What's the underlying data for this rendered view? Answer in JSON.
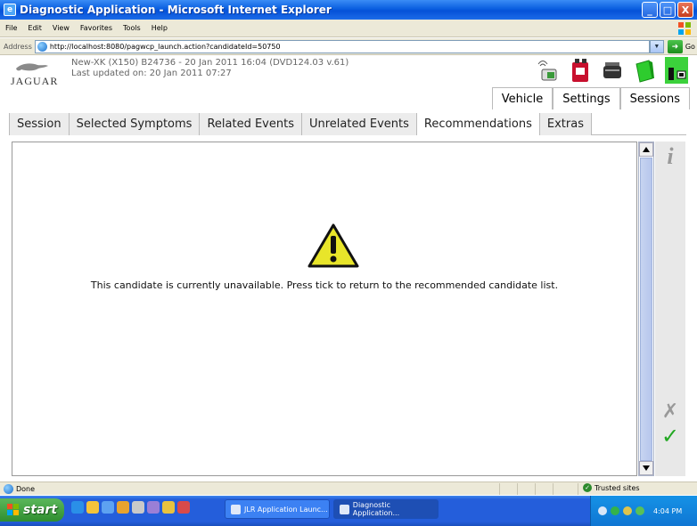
{
  "window": {
    "title": "Diagnostic Application - Microsoft Internet Explorer",
    "buttons": [
      "_",
      "□",
      "X"
    ]
  },
  "menu": {
    "items": [
      "File",
      "Edit",
      "View",
      "Favorites",
      "Tools",
      "Help"
    ]
  },
  "address": {
    "label": "Address",
    "url": "http://localhost:8080/pagwcp_launch.action?candidateId=50750",
    "go_label": "Go"
  },
  "header": {
    "logo_text": "JAGUAR",
    "vehicle_line": "New-XK (X150) B24736 - 20 Jan 2011 16:04 (DVD124.03 v.61)",
    "updated_line": "Last updated on: 20 Jan 2011 07:27",
    "tabs": [
      {
        "label": "Vehicle",
        "active": true
      },
      {
        "label": "Settings",
        "active": false
      },
      {
        "label": "Sessions",
        "active": false
      }
    ]
  },
  "main_tabs": [
    {
      "label": "Session",
      "active": false
    },
    {
      "label": "Selected Symptoms",
      "active": false
    },
    {
      "label": "Related Events",
      "active": false
    },
    {
      "label": "Unrelated Events",
      "active": false
    },
    {
      "label": "Recommendations",
      "active": true
    },
    {
      "label": "Extras",
      "active": false
    }
  ],
  "content": {
    "message": "This candidate is currently unavailable. Press tick to return to the recommended candidate list."
  },
  "side_panel": {
    "info_glyph": "i",
    "cancel_glyph": "✗",
    "confirm_glyph": "✓"
  },
  "status": {
    "text": "Done",
    "zone": "Trusted sites"
  },
  "taskbar": {
    "start_label": "start",
    "items": [
      {
        "label": "JLR Application Launc...",
        "active": false
      },
      {
        "label": "Diagnostic Application...",
        "active": true
      }
    ],
    "clock": "4:04 PM"
  },
  "colors": {
    "title_bar": "#0a5fe0",
    "tab_inactive": "#ececec",
    "scroll_thumb": "#b6c6ec",
    "confirm": "#22a822",
    "warning_fill": "#e8e52a"
  }
}
